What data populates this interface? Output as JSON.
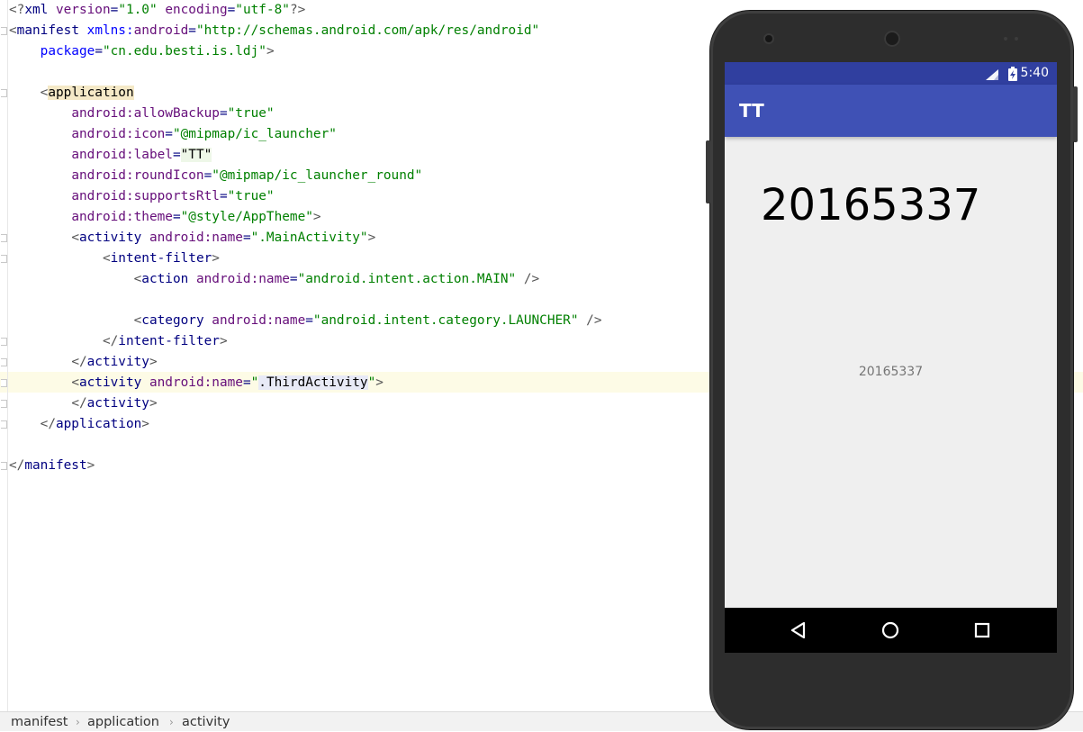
{
  "editor": {
    "lines": [
      {
        "parts": [
          [
            "br",
            "<?"
          ],
          [
            "tag",
            "xml "
          ],
          [
            "attr",
            "version"
          ],
          [
            "tag",
            "="
          ],
          [
            "str",
            "\"1.0\""
          ],
          [
            "tag",
            " "
          ],
          [
            "attr",
            "encoding"
          ],
          [
            "tag",
            "="
          ],
          [
            "str",
            "\"utf-8\""
          ],
          [
            "br",
            "?>"
          ]
        ]
      },
      {
        "parts": [
          [
            "br",
            "<"
          ],
          [
            "tag",
            "manifest "
          ],
          [
            "ns",
            "xmlns:"
          ],
          [
            "attr",
            "android"
          ],
          [
            "tag",
            "="
          ],
          [
            "str",
            "\"http://schemas.android.com/apk/res/android\""
          ]
        ]
      },
      {
        "parts": [
          [
            "tag",
            "    "
          ],
          [
            "ns",
            "package"
          ],
          [
            "tag",
            "="
          ],
          [
            "str",
            "\"cn.edu.besti.is.ldj\""
          ],
          [
            "br",
            ">"
          ]
        ]
      },
      {
        "parts": []
      },
      {
        "parts": [
          [
            "tag",
            "    "
          ],
          [
            "br",
            "<"
          ],
          [
            "hl-tag",
            "application"
          ]
        ]
      },
      {
        "parts": [
          [
            "tag",
            "        "
          ],
          [
            "attr",
            "android:allowBackup"
          ],
          [
            "tag",
            "="
          ],
          [
            "str",
            "\"true\""
          ]
        ]
      },
      {
        "parts": [
          [
            "tag",
            "        "
          ],
          [
            "attr",
            "android:icon"
          ],
          [
            "tag",
            "="
          ],
          [
            "str",
            "\"@mipmap/ic_launcher\""
          ]
        ]
      },
      {
        "parts": [
          [
            "tag",
            "        "
          ],
          [
            "attr",
            "android:label"
          ],
          [
            "tag",
            "="
          ],
          [
            "hl-val",
            "\"TT\""
          ]
        ]
      },
      {
        "parts": [
          [
            "tag",
            "        "
          ],
          [
            "attr",
            "android:roundIcon"
          ],
          [
            "tag",
            "="
          ],
          [
            "str",
            "\"@mipmap/ic_launcher_round\""
          ]
        ]
      },
      {
        "parts": [
          [
            "tag",
            "        "
          ],
          [
            "attr",
            "android:supportsRtl"
          ],
          [
            "tag",
            "="
          ],
          [
            "str",
            "\"true\""
          ]
        ]
      },
      {
        "parts": [
          [
            "tag",
            "        "
          ],
          [
            "attr",
            "android:theme"
          ],
          [
            "tag",
            "="
          ],
          [
            "str",
            "\"@style/AppTheme\""
          ],
          [
            "br",
            ">"
          ]
        ]
      },
      {
        "parts": [
          [
            "tag",
            "        "
          ],
          [
            "br",
            "<"
          ],
          [
            "tag",
            "activity "
          ],
          [
            "attr",
            "android:name"
          ],
          [
            "tag",
            "="
          ],
          [
            "str",
            "\".MainActivity\""
          ],
          [
            "br",
            ">"
          ]
        ]
      },
      {
        "parts": [
          [
            "tag",
            "            "
          ],
          [
            "br",
            "<"
          ],
          [
            "tag",
            "intent-filter"
          ],
          [
            "br",
            ">"
          ]
        ]
      },
      {
        "parts": [
          [
            "tag",
            "                "
          ],
          [
            "br",
            "<"
          ],
          [
            "tag",
            "action "
          ],
          [
            "attr",
            "android:name"
          ],
          [
            "tag",
            "="
          ],
          [
            "str",
            "\"android.intent.action.MAIN\""
          ],
          [
            "tag",
            " "
          ],
          [
            "br",
            "/>"
          ]
        ]
      },
      {
        "parts": []
      },
      {
        "parts": [
          [
            "tag",
            "                "
          ],
          [
            "br",
            "<"
          ],
          [
            "tag",
            "category "
          ],
          [
            "attr",
            "android:name"
          ],
          [
            "tag",
            "="
          ],
          [
            "str",
            "\"android.intent.category.LAUNCHER\""
          ],
          [
            "tag",
            " "
          ],
          [
            "br",
            "/>"
          ]
        ]
      },
      {
        "parts": [
          [
            "tag",
            "            "
          ],
          [
            "br",
            "</"
          ],
          [
            "tag",
            "intent-filter"
          ],
          [
            "br",
            ">"
          ]
        ]
      },
      {
        "parts": [
          [
            "tag",
            "        "
          ],
          [
            "br",
            "</"
          ],
          [
            "tag",
            "activity"
          ],
          [
            "br",
            ">"
          ]
        ]
      },
      {
        "parts": [
          [
            "tag",
            "        "
          ],
          [
            "br",
            "<"
          ],
          [
            "tag",
            "activity "
          ],
          [
            "attr",
            "android:name"
          ],
          [
            "tag",
            "="
          ],
          [
            "str",
            "\""
          ],
          [
            "hl-name",
            ".ThirdActivity"
          ],
          [
            "str",
            "\""
          ],
          [
            "br",
            ">"
          ]
        ]
      },
      {
        "parts": [
          [
            "tag",
            "        "
          ],
          [
            "br",
            "</"
          ],
          [
            "tag",
            "activity"
          ],
          [
            "br",
            ">"
          ]
        ]
      },
      {
        "parts": [
          [
            "tag",
            "    "
          ],
          [
            "br",
            "</"
          ],
          [
            "tag",
            "application"
          ],
          [
            "br",
            ">"
          ]
        ]
      },
      {
        "parts": []
      },
      {
        "parts": [
          [
            "br",
            "</"
          ],
          [
            "tag",
            "manifest"
          ],
          [
            "br",
            ">"
          ]
        ]
      }
    ]
  },
  "breadcrumb": {
    "items": [
      "manifest",
      "application",
      "activity"
    ],
    "separator": "›"
  },
  "phone": {
    "status_time": "5:40",
    "app_title": "TT",
    "big_text": "20165337",
    "small_text": "20165337",
    "icons": {
      "signal": "signal-icon",
      "battery": "battery-charging-icon",
      "back": "back-triangle-icon",
      "home": "home-circle-icon",
      "recents": "recents-square-icon"
    }
  },
  "colors": {
    "status_bar": "#303f9f",
    "app_bar": "#3f51b5",
    "screen_bg": "#efefef",
    "xml_tag": "#000080",
    "xml_attr": "#660e7a",
    "xml_string": "#008000",
    "xml_namespace": "#0000ff"
  }
}
